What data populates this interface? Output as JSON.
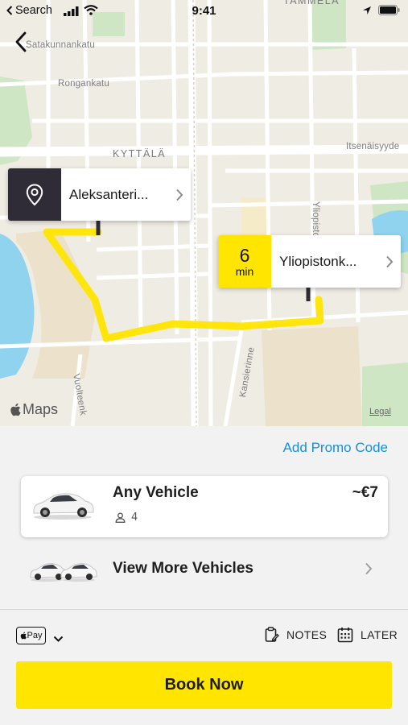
{
  "status_bar": {
    "back_app_label": "Search",
    "time": "9:41"
  },
  "map": {
    "streets": {
      "satakunnankatu": "Satakunnankatu",
      "rongankatu": "Rongankatu",
      "itsenaisyydenkatu": "Itsenäisyyde",
      "yliopistonkatu": "Yliopistonk",
      "kansikatu": "Kansierinne",
      "vuolteenkatu": "Vuolteenk"
    },
    "districts": {
      "kyttala": "KYTTÄLÄ",
      "tammela": "TAMMELA"
    },
    "maps_brand": "Maps",
    "legal": "Legal",
    "route_color": "#ffe500"
  },
  "pickup": {
    "label": "Aleksanteri...",
    "icon": "location-pin-icon"
  },
  "dropoff": {
    "label": "Yliopistonk...",
    "eta_value": "6",
    "eta_unit": "min"
  },
  "panel": {
    "promo_link": "Add Promo Code",
    "selected_vehicle": {
      "name": "Any Vehicle",
      "seats": "4",
      "price": "~€7"
    },
    "more_vehicles_label": "View More Vehicles",
    "payment": {
      "method": "Pay"
    },
    "notes_label": "NOTES",
    "later_label": "LATER",
    "book_label": "Book Now"
  },
  "colors": {
    "accent": "#ffe500",
    "link": "#1a8fd6",
    "dark": "#2f2c38"
  }
}
